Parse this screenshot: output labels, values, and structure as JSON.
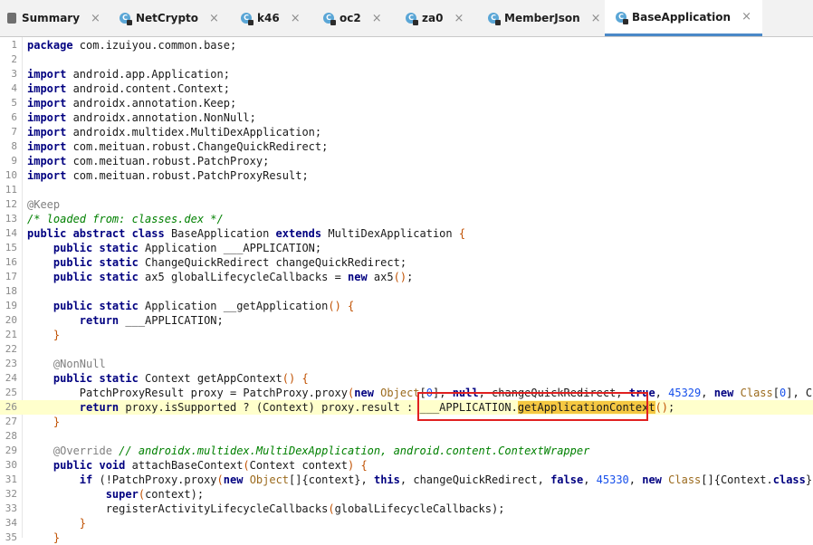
{
  "tabs": [
    {
      "label": "Summary",
      "icon": "document-icon"
    },
    {
      "label": "NetCrypto",
      "icon": "class-icon"
    },
    {
      "label": "k46",
      "icon": "class-icon"
    },
    {
      "label": "oc2",
      "icon": "class-icon"
    },
    {
      "label": "za0",
      "icon": "class-icon"
    },
    {
      "label": "MemberJson",
      "icon": "class-icon"
    },
    {
      "label": "BaseApplication",
      "icon": "class-icon",
      "active": true
    }
  ],
  "close_glyph": "×",
  "icon_letter": "C",
  "lines": {
    "l1": {
      "n": "1",
      "a": "package",
      "b": " com.izuiyou.common.base;"
    },
    "l2": {
      "n": "2"
    },
    "l3": {
      "n": "3",
      "a": "import",
      "b": " android.app.Application;"
    },
    "l4": {
      "n": "4",
      "a": "import",
      "b": " android.content.Context;"
    },
    "l5": {
      "n": "5",
      "a": "import",
      "b": " androidx.annotation.Keep;"
    },
    "l6": {
      "n": "6",
      "a": "import",
      "b": " androidx.annotation.NonNull;"
    },
    "l7": {
      "n": "7",
      "a": "import",
      "b": " androidx.multidex.MultiDexApplication;"
    },
    "l8": {
      "n": "8",
      "a": "import",
      "b": " com.meituan.robust.ChangeQuickRedirect;"
    },
    "l9": {
      "n": "9",
      "a": "import",
      "b": " com.meituan.robust.PatchProxy;"
    },
    "l10": {
      "n": "10",
      "a": "import",
      "b": " com.meituan.robust.PatchProxyResult;"
    },
    "l11": {
      "n": "11"
    },
    "l12": {
      "n": "12",
      "a": "@Keep"
    },
    "l13": {
      "n": "13",
      "a": "/* loaded from: classes.dex */"
    },
    "l14": {
      "n": "14",
      "a": "public abstract class",
      "b": " BaseApplication ",
      "c": "extends",
      "d": " MultiDexApplication ",
      "e": "{"
    },
    "l15": {
      "n": "15",
      "a": "    public static",
      "b": " Application ___APPLICATION;"
    },
    "l16": {
      "n": "16",
      "a": "    public static",
      "b": " ChangeQuickRedirect changeQuickRedirect;"
    },
    "l17": {
      "n": "17",
      "a": "    public static",
      "b": " ax5 globalLifecycleCallbacks = ",
      "c": "new",
      "d": " ax5",
      "e": "()",
      ";": ";"
    },
    "l18": {
      "n": "18"
    },
    "l19": {
      "n": "19",
      "a": "    public static",
      "b": " Application __getApplication",
      "c": "()",
      "d": " ",
      "e": "{"
    },
    "l20": {
      "n": "20",
      "a": "        return",
      "b": " ___APPLICATION;"
    },
    "l21": {
      "n": "21",
      "a": "    }"
    },
    "l22": {
      "n": "22"
    },
    "l23": {
      "n": "23",
      "a": "    @NonNull"
    },
    "l24": {
      "n": "24",
      "a": "    public static",
      "b": " Context getAppContext",
      "c": "()",
      "d": " ",
      "e": "{"
    },
    "l25": {
      "n": "25",
      "a": "        PatchProxyResult proxy = PatchProxy.proxy",
      "b": "(",
      "c": "new",
      "d": " ",
      "e": "Object",
      "f": "[",
      "g": "0",
      "h": "], ",
      "i": "null",
      ", ": ", changeQuickRedirect, ",
      "j": "true",
      ",2": ", ",
      "k": "45329",
      ",3": ", ",
      "l": "new",
      "sp": " ",
      "m": "Class",
      "n2": "[",
      "o": "0",
      "p": "], Conte"
    },
    "l26": {
      "n": "26",
      "a": "        return",
      "b": " proxy.isSupported ? (Context) proxy.result : ___APPLICATION.",
      "c": "getApplicationContext",
      "d": "()",
      ";": ";"
    },
    "l27": {
      "n": "27",
      "a": "    }"
    },
    "l28": {
      "n": "28"
    },
    "l29": {
      "n": "29",
      "a": "    @Override",
      "b": " // androidx.multidex.MultiDexApplication, android.content.ContextWrapper"
    },
    "l30": {
      "n": "30",
      "a": "    public void",
      "b": " attachBaseContext",
      "c": "(",
      "d": "Context context",
      "e": ")",
      " ": " ",
      "f": "{"
    },
    "l31": {
      "n": "31",
      "a": "        if",
      "b": " (!PatchProxy.proxy",
      "c": "(",
      "d": "new",
      "e": " ",
      "f": "Object",
      "g": "[]",
      "h": "{context}, ",
      "i": "this",
      ", ": ", changeQuickRedirect, ",
      "j": "false",
      ",2": ", ",
      "k": "45330",
      ",3": ", ",
      "l": "new",
      "sp": " ",
      "m": "Class",
      "n2": "[]",
      "o": "{Context.",
      "p": "class",
      "q": "}, Vo"
    },
    "l32": {
      "n": "32",
      "a": "            super",
      ".": ".attachBaseContext",
      "b": "(",
      "c": "context",
      "d": ");"
    },
    "l33": {
      "n": "33",
      "a": "            registerActivityLifecycleCallbacks",
      "b": "(",
      "c": "globalLifecycleCallbacks",
      "d": ");"
    },
    "l34": {
      "n": "34",
      "a": "        }"
    },
    "l35": {
      "n": "35",
      "a": "    }"
    }
  },
  "colors": {
    "keyword": "#000080",
    "annotation": "#808080",
    "comment": "#008000",
    "number": "#1750eb",
    "highlight_box": "#e02020",
    "current_line": "#ffffcc",
    "selection": "#f5c842"
  }
}
